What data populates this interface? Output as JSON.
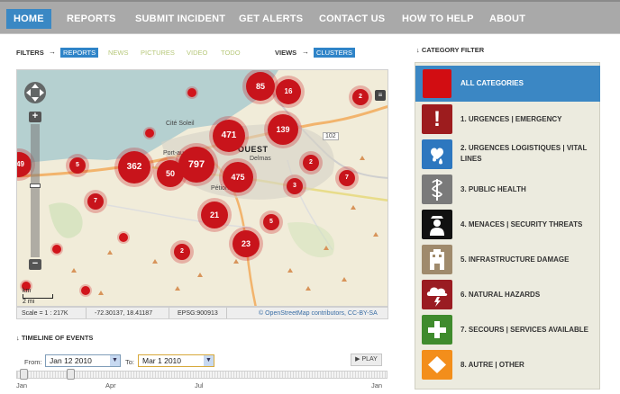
{
  "nav": {
    "items": [
      {
        "label": "HOME",
        "active": true
      },
      {
        "label": "REPORTS",
        "active": false
      },
      {
        "label": "SUBMIT INCIDENT",
        "active": false
      },
      {
        "label": "GET ALERTS",
        "active": false
      },
      {
        "label": "CONTACT US",
        "active": false
      },
      {
        "label": "HOW TO HELP",
        "active": false
      },
      {
        "label": "ABOUT",
        "active": false
      }
    ]
  },
  "filters": {
    "label": "FILTERS",
    "options": [
      "REPORTS",
      "NEWS",
      "PICTURES",
      "VIDEO",
      "TODO"
    ],
    "selected": "REPORTS",
    "views_label": "VIEWS",
    "views_selected": "CLUSTERS"
  },
  "map": {
    "clusters": [
      "85",
      "16",
      "471",
      "139",
      "362",
      "797",
      "50",
      "475",
      "21",
      "23",
      "2",
      "5",
      "2",
      "7",
      "3",
      "5",
      "7",
      "2",
      "49"
    ],
    "place_labels": [
      "OUEST",
      "Cité Soleil",
      "Port-au-Prince",
      "Delmas",
      "Pétion-Ville",
      "102"
    ],
    "status": {
      "scale": "Scale = 1 : 217K",
      "coords": "-72.30137, 18.41187",
      "epsg": "EPSG:900913",
      "attribution": "© OpenStreetMap contributors, CC-BY-SA"
    },
    "scale_km": "km",
    "scale_mi": "2 mi"
  },
  "timeline": {
    "title": "TIMELINE OF EVENTS",
    "from_label": "From:",
    "from_value": "Jan 12 2010",
    "to_label": "To:",
    "to_value": "Mar 1 2010",
    "play_label": "PLAY",
    "axis_labels": [
      "Jan",
      "Apr",
      "Jul",
      "Jan"
    ]
  },
  "categories": {
    "title": "CATEGORY FILTER",
    "all_label": "ALL CATEGORIES",
    "items": [
      {
        "label": "1. URGENCES | EMERGENCY",
        "color": "#9d1c1e",
        "icon": "exclamation-icon"
      },
      {
        "label": "2. URGENCES LOGISTIQUES | VITAL LINES",
        "color": "#2d77bf",
        "icon": "water-heart-icon"
      },
      {
        "label": "3. PUBLIC HEALTH",
        "color": "#7a7a7a",
        "icon": "medical-caduceus-icon"
      },
      {
        "label": "4. MENACES | SECURITY THREATS",
        "color": "#111111",
        "icon": "security-guard-icon"
      },
      {
        "label": "5. INFRASTRUCTURE DAMAGE",
        "color": "#9f8a6c",
        "icon": "damaged-building-icon"
      },
      {
        "label": "6. NATURAL HAZARDS",
        "color": "#9a1c22",
        "icon": "storm-cloud-icon"
      },
      {
        "label": "7. SECOURS | SERVICES AVAILABLE",
        "color": "#3f8b2d",
        "icon": "plus-icon"
      },
      {
        "label": "8. AUTRE | OTHER",
        "color": "#f38e1b",
        "icon": "diamond-icon"
      }
    ],
    "all_color": "#d20d12"
  }
}
